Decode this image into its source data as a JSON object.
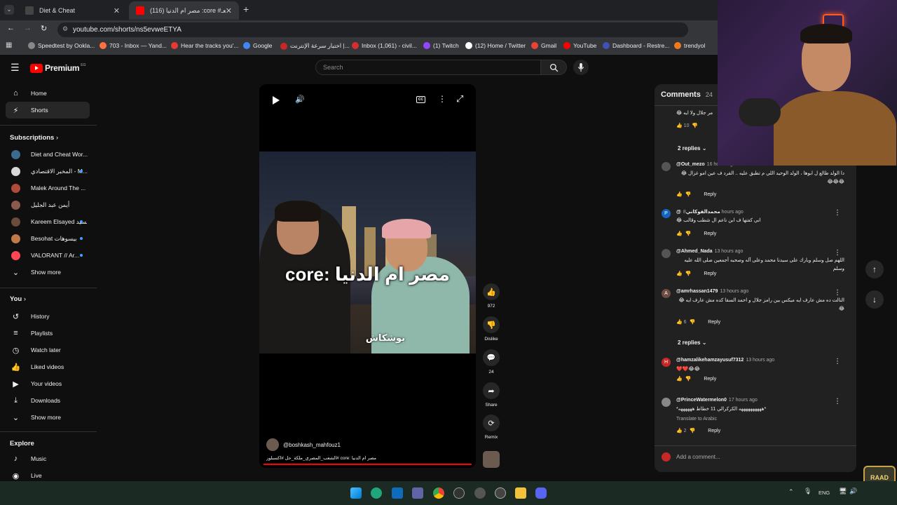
{
  "browser": {
    "tabs": [
      {
        "title": "Diet & Cheat",
        "active": false
      },
      {
        "title": "(116) مصر ام الدنيا :core #الشعـ",
        "active": true
      }
    ],
    "url": "youtube.com/shorts/ns5evweETYA",
    "bookmarks": [
      "Speedtest by Ookla...",
      "703 - Inbox — Yand...",
      "Hear the tracks you'...",
      "Google",
      "اختبار سرعة الإنترنت |...",
      "Inbox (1,061) - civil...",
      "(1) Twitch",
      "(12) Home / Twitter",
      "Gmail",
      "YouTube",
      "Dashboard - Restre...",
      "trendyol"
    ]
  },
  "youtube": {
    "logo": "Premium",
    "logo_region": "EG",
    "search_placeholder": "Search",
    "nav": [
      {
        "label": "Home",
        "icon": "home-icon"
      },
      {
        "label": "Shorts",
        "icon": "shorts-icon",
        "active": true
      }
    ],
    "subscriptions_title": "Subscriptions",
    "subscriptions": [
      {
        "label": "Diet and Cheat Wor...",
        "color": "#3d6b8e",
        "dot": false
      },
      {
        "label": "المخبر الاقتصادي - M...",
        "color": "#d9d9d9",
        "dot": true
      },
      {
        "label": "Malek Around The ...",
        "color": "#b04a3a",
        "dot": false
      },
      {
        "label": "أيمن عبد الجليل",
        "color": "#8a5a4a",
        "dot": false
      },
      {
        "label": "Kareem Elsayed كريم السيد",
        "color": "#6b4b3b",
        "dot": true
      },
      {
        "label": "Besohat بيسوهات",
        "color": "#c07a4a",
        "dot": true
      },
      {
        "label": "VALORANT // Ar...",
        "color": "#ff4655",
        "dot": true
      }
    ],
    "show_more": "Show more",
    "you_title": "You",
    "you_items": [
      {
        "label": "History",
        "icon": "history-icon"
      },
      {
        "label": "Playlists",
        "icon": "playlists-icon"
      },
      {
        "label": "Watch later",
        "icon": "watch-later-icon"
      },
      {
        "label": "Liked videos",
        "icon": "liked-icon"
      },
      {
        "label": "Your videos",
        "icon": "your-videos-icon"
      },
      {
        "label": "Downloads",
        "icon": "downloads-icon"
      }
    ],
    "show_more_2": "Show more",
    "explore_title": "Explore",
    "explore_items": [
      {
        "label": "Music",
        "icon": "music-icon"
      },
      {
        "label": "Live",
        "icon": "live-icon"
      }
    ]
  },
  "short": {
    "overlay_title": "مصر ام الدنيا :core",
    "overlay_sub": "بوشكاش",
    "channel": "@boshkash_mahfouz1",
    "caption": "مصر ام الدنيا :core #الشعب_المصري_ملكة_حل #اكسبلور",
    "likes": "972",
    "dislike_label": "Dislike",
    "comments_count": "24",
    "share_label": "Share",
    "remix_label": "Remix"
  },
  "comments": {
    "title": "Comments",
    "count": "24",
    "top_text": "مر جلال ولا ايه 😂",
    "top_likes": "10",
    "replies_1": "2 replies",
    "items": [
      {
        "user": "@Out_mezo",
        "time": "16 hours ago",
        "text": "دا الولد طالع ل ابوها ، الولد الوحيد اللي م تطبق عليه .. القرد ف عين امو غزال 😂😂😂😂",
        "likes": "",
        "reply": "Reply",
        "avatar": "#555",
        "initial": ""
      },
      {
        "user": "@محمدالفوكاني",
        "time": "8 hours ago",
        "text": "اني كفتها ف ابن ناعم ال شطب وقالب 😂",
        "likes": "",
        "reply": "Reply",
        "avatar": "#1565c0",
        "initial": "P"
      },
      {
        "user": "@Ahmed_Nada",
        "time": "13 hours ago",
        "text": "اللهم صل وسلم وبارك على سيدنا محمد وعلى آله وصحبه أجمعين صلى الله عليه وسلم",
        "likes": "",
        "reply": "Reply",
        "avatar": "#555",
        "initial": ""
      },
      {
        "user": "@amrhassan1479",
        "time": "13 hours ago",
        "text": "التالت ده مش عارف ايه ميكس بين رامز جلال و احمد السقا كده مش عارف ايه 😂😂",
        "likes": "6",
        "reply": "Reply",
        "avatar": "#6d4c41",
        "initial": "A"
      },
      {
        "user": "@hamzalikehamzayusuf7312",
        "time": "13 hours ago",
        "text": "❤️❤️😂😂",
        "likes": "",
        "reply": "Reply",
        "avatar": "#c62828",
        "initial": "H"
      },
      {
        "user": "@PrinceWatermelon0",
        "time": "17 hours ago",
        "text": "*ههههههههههه الكركرالي 11 خطاط ههههههه*",
        "likes": "2",
        "reply": "Reply",
        "avatar": "#888",
        "initial": ""
      }
    ],
    "replies_2": "2 replies",
    "translate": "Translate to Arabic",
    "add_placeholder": "Add a comment..."
  },
  "taskbar": {
    "lang": "ENG"
  },
  "overlay_logo": "RAAD"
}
